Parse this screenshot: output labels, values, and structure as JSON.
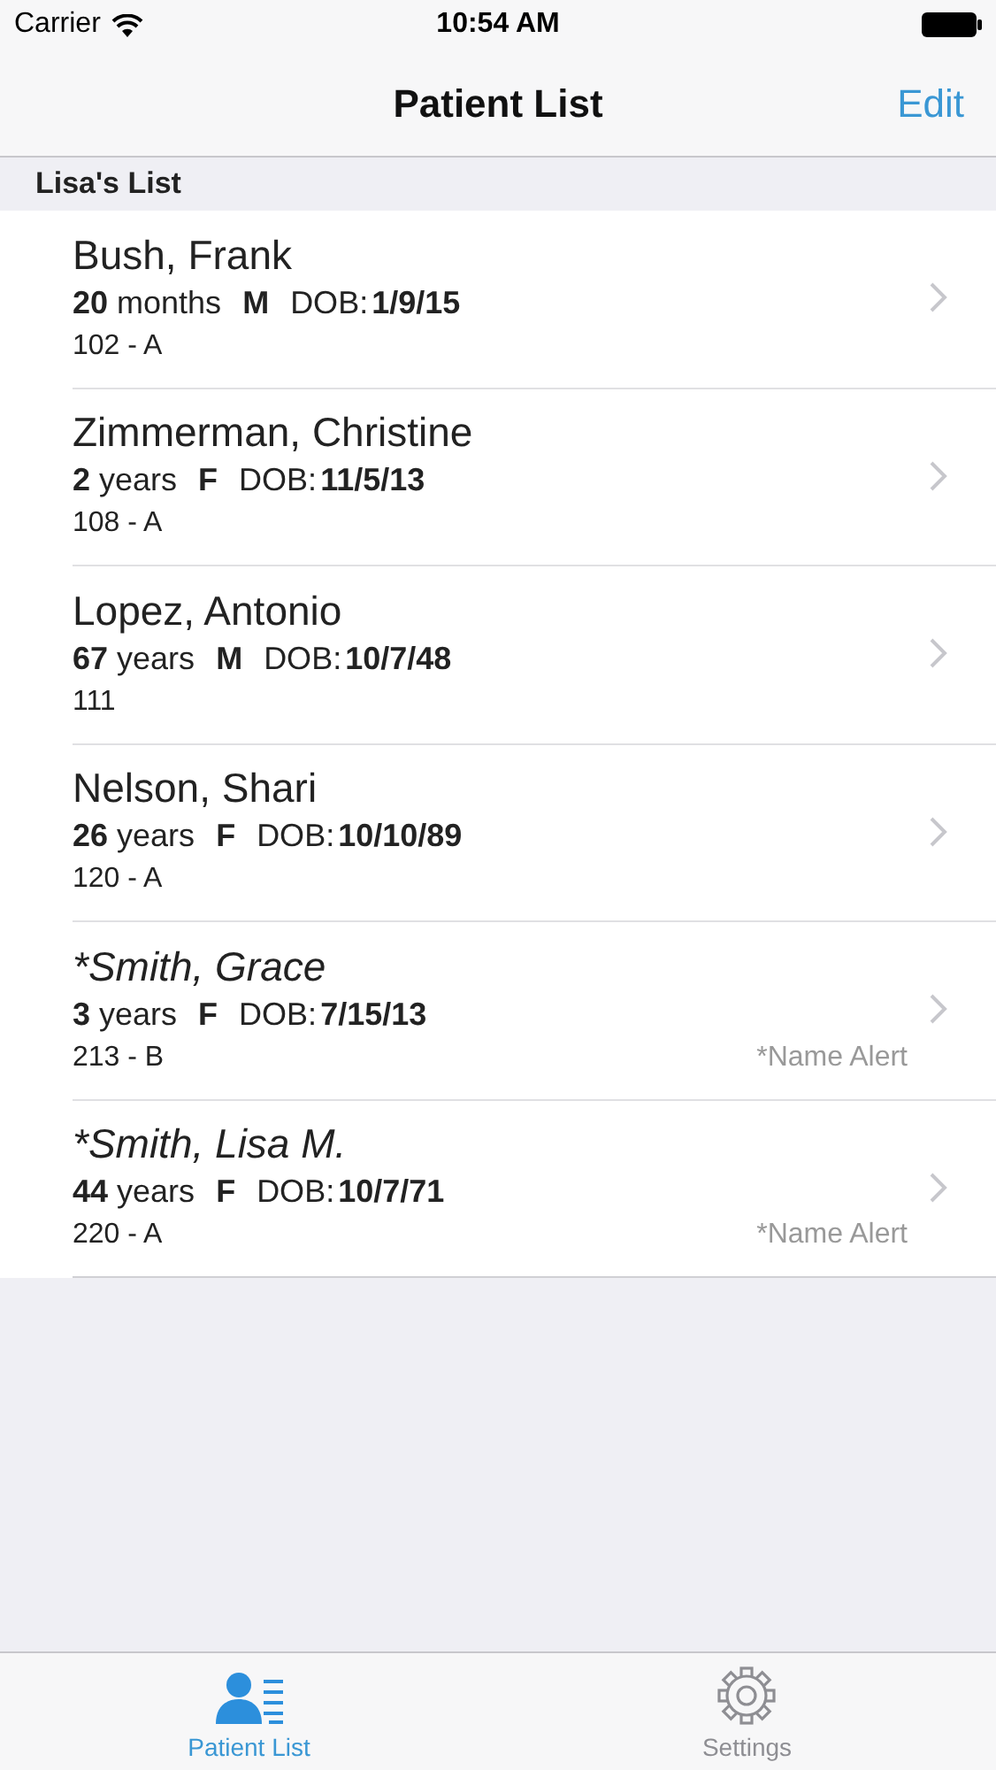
{
  "status_bar": {
    "carrier": "Carrier",
    "time": "10:54 AM"
  },
  "nav": {
    "title": "Patient List",
    "action": "Edit"
  },
  "section": {
    "title": "Lisa's List"
  },
  "patients": [
    {
      "name": "Bush, Frank",
      "flagged": false,
      "age": "**20** months",
      "sex": "M",
      "dob_label": "DOB:",
      "dob": "1/9/15",
      "room": "102 - A"
    },
    {
      "name": "Zimmerman, Christine",
      "flagged": false,
      "age": "**2** years",
      "sex": "F",
      "dob_label": "DOB:",
      "dob": "11/5/13",
      "room": "108 - A"
    },
    {
      "name": "Lopez, Antonio",
      "flagged": false,
      "age": "**67** years",
      "sex": "M",
      "dob_label": "DOB:",
      "dob": "10/7/48",
      "room": "111"
    },
    {
      "name": "Nelson, Shari",
      "flagged": false,
      "age": "**26** years",
      "sex": "F",
      "dob_label": "DOB:",
      "dob": "10/10/89",
      "room": "120 - A"
    },
    {
      "name": "*Smith, Grace",
      "flagged": true,
      "age": "**3** years",
      "sex": "F",
      "dob_label": "DOB:",
      "dob": "7/15/13",
      "room": "213 - B",
      "alert": "*Name Alert"
    },
    {
      "name": "*Smith, Lisa M.",
      "flagged": true,
      "age": "**44** years",
      "sex": "F",
      "dob_label": "DOB:",
      "dob": "10/7/71",
      "room": "220 - A",
      "alert": "*Name Alert"
    }
  ],
  "tab_bar": [
    {
      "label": "Patient List",
      "kind": "patients",
      "selected": true
    },
    {
      "label": "Settings",
      "kind": "settings",
      "selected": false
    }
  ]
}
